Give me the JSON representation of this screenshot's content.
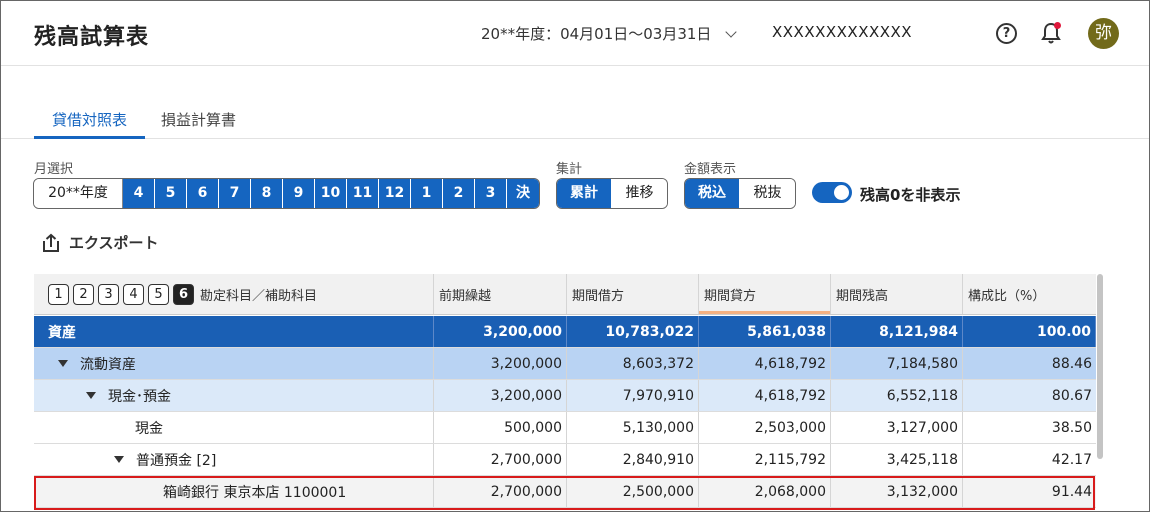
{
  "header": {
    "title": "残高試算表",
    "period": "20**年度：04月01日〜03月31日",
    "company": "XXXXXXXXXXXXX",
    "help_icon": "?",
    "avatar": "弥"
  },
  "tabs": [
    {
      "label": "貸借対照表",
      "active": true
    },
    {
      "label": "損益計算書",
      "active": false
    }
  ],
  "filters": {
    "month_label": "月選択",
    "months": [
      "20**年度",
      "4",
      "5",
      "6",
      "7",
      "8",
      "9",
      "10",
      "11",
      "12",
      "1",
      "2",
      "3",
      "決"
    ],
    "aggregate_label": "集計",
    "aggregate": [
      "累計",
      "推移"
    ],
    "amount_label": "金額表示",
    "amount": [
      "税込",
      "税抜"
    ],
    "hide_zero_label": "残高0を非表示",
    "hide_zero_on": true
  },
  "export_label": "エクスポート",
  "table": {
    "levels": [
      "1",
      "2",
      "3",
      "4",
      "5",
      "6"
    ],
    "active_level": "6",
    "account_header": "勘定科目／補助科目",
    "columns": [
      "前期繰越",
      "期間借方",
      "期間貸方",
      "期間残高",
      "構成比（%）"
    ],
    "rows": [
      {
        "name": "資産",
        "values": [
          "3,200,000",
          "10,783,022",
          "5,861,038",
          "8,121,984",
          "100.00"
        ]
      },
      {
        "name": "流動資産",
        "values": [
          "3,200,000",
          "8,603,372",
          "4,618,792",
          "7,184,580",
          "88.46"
        ]
      },
      {
        "name": "現金･預金",
        "values": [
          "3,200,000",
          "7,970,910",
          "4,618,792",
          "6,552,118",
          "80.67"
        ]
      },
      {
        "name": "現金",
        "values": [
          "500,000",
          "5,130,000",
          "2,503,000",
          "3,127,000",
          "38.50"
        ]
      },
      {
        "name": "普通預金 [2]",
        "values": [
          "2,700,000",
          "2,840,910",
          "2,115,792",
          "3,425,118",
          "42.17"
        ]
      },
      {
        "name": "箱崎銀行 東京本店 1100001",
        "values": [
          "2,700,000",
          "2,500,000",
          "2,068,000",
          "3,132,000",
          "91.44"
        ]
      }
    ]
  },
  "colors": {
    "accent": "#1565c0",
    "highlight": "#d81b1b",
    "avatar_bg": "#726a1a"
  }
}
